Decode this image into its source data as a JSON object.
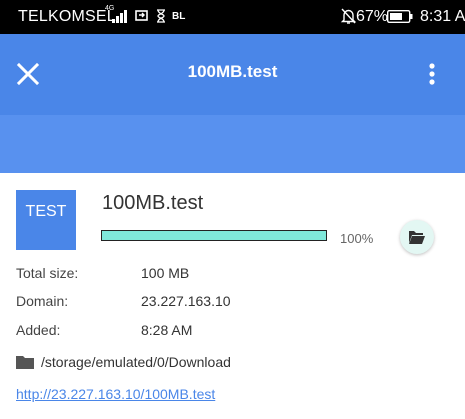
{
  "status_bar": {
    "carrier": "TELKOMSEL",
    "network": "4G",
    "indicator": "BL",
    "battery_percent": "67%",
    "time": "8:31 AM",
    "icons": [
      "signal-icon",
      "sync-icon",
      "hourglass-icon",
      "mute-icon",
      "battery-icon"
    ]
  },
  "toolbar": {
    "title": "100MB.test",
    "close_icon": "close-icon",
    "menu_icon": "more-vert-icon",
    "color": "#4a86e8"
  },
  "download": {
    "file_type_label": "TEST",
    "file_name": "100MB.test",
    "progress": 1.0,
    "progress_text": "100%",
    "progress_color": "#7fe8da",
    "open_folder_icon": "folder-open-icon",
    "details": [
      {
        "label": "Total size:",
        "value": "100 MB"
      },
      {
        "label": "Domain:",
        "value": "23.227.163.10"
      },
      {
        "label": "Added:",
        "value": "8:28 AM"
      }
    ],
    "path": "/storage/emulated/0/Download",
    "url": "http://23.227.163.10/100MB.test"
  }
}
